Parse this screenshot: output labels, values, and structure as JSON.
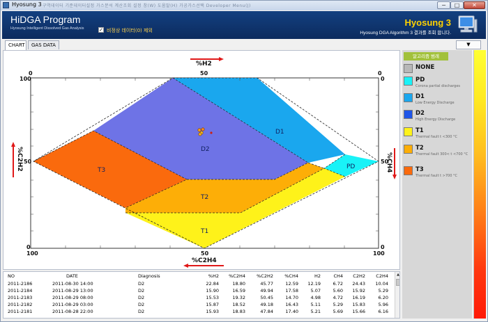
{
  "window": {
    "title": "Hyosung 3",
    "menu_faint": "구역데이터    기준데이터설정    가스분석    계산조회    설정    창(W)    도움말(H)    가공가스선택    Developer Menu(J)",
    "buttons": {
      "minimize": "−",
      "maximize": "□",
      "close": "✕"
    }
  },
  "header": {
    "program_title": "HiDGA Program",
    "program_subtitle": "Hyosung Intelligent Dissolved Gas Analysis",
    "checkbox_label": "비정상 데이터(0) 제외",
    "checkbox_checked": true,
    "brand": "Hyosung 3",
    "algo_text": "Hyosung DGA Algorithm 3 결과를 조회 합니다.",
    "icons": [
      "computer-icon"
    ]
  },
  "tabs": [
    {
      "label": "CHART",
      "active": true
    },
    {
      "label": "GAS DATA",
      "active": false
    }
  ],
  "dropdown": {
    "symbol": "▼"
  },
  "chart": {
    "top_label": "%H2",
    "bottom_label": "%C2H4",
    "left_label": "%C2H2",
    "right_label": "%CH4",
    "ticks": {
      "top_left": "0",
      "top_mid": "50",
      "top_right": "0",
      "left_top": "100",
      "left_mid": "50",
      "left_bottom": "0",
      "bottom_left": "100",
      "bottom_mid": "50",
      "bottom_right": "100",
      "right_top": "0",
      "right_mid": "50",
      "right_bottom": "0"
    },
    "zones": [
      {
        "code": "D1",
        "color": "#1aa7ee"
      },
      {
        "code": "D2",
        "color": "#6e73e6"
      },
      {
        "code": "PD",
        "color": "#19f2f7"
      },
      {
        "code": "T3",
        "color": "#fa6a0d"
      },
      {
        "code": "T2",
        "color": "#fdae07"
      },
      {
        "code": "T1",
        "color": "#fef21a"
      }
    ]
  },
  "legend": {
    "header": "알고리즘 범례",
    "items": [
      {
        "code": "NONE",
        "desc": "",
        "color": "#b8b8b8"
      },
      {
        "code": "PD",
        "desc": "Corona partial discharges",
        "color": "#19f2f7"
      },
      {
        "code": "D1",
        "desc": "Low Energy Discharge",
        "color": "#1aa7ee"
      },
      {
        "code": "D2",
        "desc": "High Energy Discharge",
        "color": "#1f55e8"
      },
      {
        "code": "T1",
        "desc": "Thermal fault t <300 °C",
        "color": "#fef21a"
      },
      {
        "code": "T2",
        "desc": "Thermal fault 300< t <700 °C",
        "color": "#fdae07"
      },
      {
        "code": "T3",
        "desc": "Thermal fault t >700 °C",
        "color": "#fa6a0d"
      }
    ]
  },
  "table": {
    "columns": [
      "NO",
      "DATE",
      "Diagnosis",
      "%H2",
      "%C2H4",
      "%C2H2",
      "%CH4",
      "H2",
      "CH4",
      "C2H2",
      "C2H4"
    ],
    "rows": [
      [
        "2011-2186",
        "2011-08-30 14:00",
        "D2",
        "22.84",
        "18.80",
        "45.77",
        "12.59",
        "12.19",
        "6.72",
        "24.43",
        "10.04"
      ],
      [
        "2011-2184",
        "2011-08-29 13:00",
        "D2",
        "15.90",
        "16.59",
        "49.94",
        "17.58",
        "5.07",
        "5.60",
        "15.92",
        "5.29"
      ],
      [
        "2011-2183",
        "2011-08-29 08:00",
        "D2",
        "15.53",
        "19.32",
        "50.45",
        "14.70",
        "4.98",
        "4.72",
        "16.19",
        "6.20"
      ],
      [
        "2011-2182",
        "2011-08-29 03:00",
        "D2",
        "15.87",
        "18.52",
        "49.18",
        "16.43",
        "5.11",
        "5.29",
        "15.83",
        "5.96"
      ],
      [
        "2011-2181",
        "2011-08-28 22:00",
        "D2",
        "15.93",
        "18.83",
        "47.84",
        "17.40",
        "5.21",
        "5.69",
        "15.66",
        "6.16"
      ]
    ]
  },
  "scroll": {
    "up": "▲"
  }
}
